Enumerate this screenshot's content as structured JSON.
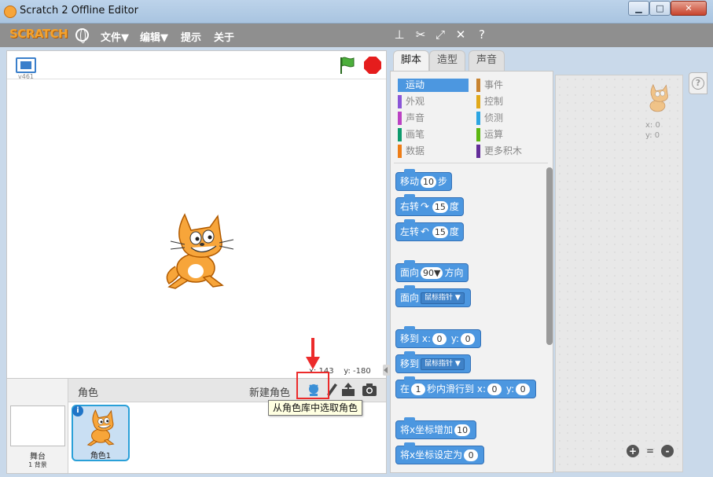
{
  "window": {
    "title": "Scratch 2 Offline Editor",
    "minimize_label": "▁",
    "maximize_label": "□",
    "close_label": "✕"
  },
  "menubar": {
    "logo": "SCRATCH",
    "items": [
      "文件▼",
      "编辑▼",
      "提示",
      "关于"
    ],
    "tool_icons": [
      "duplicate-stamp-icon",
      "cut-icon",
      "grow-icon",
      "shrink-icon",
      "help-icon"
    ]
  },
  "stage": {
    "version": "v461",
    "mouse_x_label": "x:",
    "mouse_x": "143",
    "mouse_y_label": "y:",
    "mouse_y": "-180"
  },
  "sprite_panel": {
    "sprites_label": "角色",
    "new_sprite_label": "新建角色",
    "tooltip": "从角色库中选取角色",
    "stage_label": "舞台",
    "backdrop_count": "1 背景",
    "sprites": [
      {
        "name": "角色1",
        "info": "i"
      }
    ]
  },
  "tabs": [
    {
      "label": "脚本",
      "active": true
    },
    {
      "label": "造型",
      "active": false
    },
    {
      "label": "声音",
      "active": false
    }
  ],
  "categories": {
    "left": [
      {
        "label": "运动",
        "color": "#4c97e0",
        "active": true
      },
      {
        "label": "外观",
        "color": "#8a55d7"
      },
      {
        "label": "声音",
        "color": "#bb42c3"
      },
      {
        "label": "画笔",
        "color": "#0e9a6c"
      },
      {
        "label": "数据",
        "color": "#ee7d16"
      }
    ],
    "right": [
      {
        "label": "事件",
        "color": "#c88330"
      },
      {
        "label": "控制",
        "color": "#e1a91a"
      },
      {
        "label": "侦测",
        "color": "#2ca5e2"
      },
      {
        "label": "运算",
        "color": "#5cb712"
      },
      {
        "label": "更多积木",
        "color": "#632d99"
      }
    ]
  },
  "blocks": {
    "move": {
      "text1": "移动",
      "value": "10",
      "text2": "步"
    },
    "turn_right": {
      "text1": "右转",
      "icon": "↷",
      "value": "15",
      "text2": "度"
    },
    "turn_left": {
      "text1": "左转",
      "icon": "↶",
      "value": "15",
      "text2": "度"
    },
    "point_direction": {
      "text1": "面向",
      "value": "90▼",
      "text2": "方向"
    },
    "point_towards": {
      "text1": "面向",
      "dropdown": "鼠标指针 ▼"
    },
    "goto_xy": {
      "text1": "移到",
      "x_label": "x:",
      "x": "0",
      "y_label": "y:",
      "y": "0"
    },
    "goto": {
      "text1": "移到",
      "dropdown": "鼠标指针 ▼"
    },
    "glide": {
      "text1": "在",
      "secs": "1",
      "text2": "秒内滑行到",
      "x_label": "x:",
      "x": "0",
      "y_label": "y:",
      "y": "0"
    },
    "change_x": {
      "text1": "将x坐标增加",
      "value": "10"
    },
    "set_x": {
      "text1": "将x坐标设定为",
      "value": "0"
    }
  },
  "scripts_area": {
    "sprite_x_label": "x:",
    "sprite_x": "0",
    "sprite_y_label": "y:",
    "sprite_y": "0",
    "zoom_in": "+",
    "zoom_reset": "=",
    "zoom_out": "-"
  },
  "colors": {
    "motion": "#4c97e0",
    "menubar": "#8f8f8f",
    "highlight": "#ec2b2b"
  }
}
